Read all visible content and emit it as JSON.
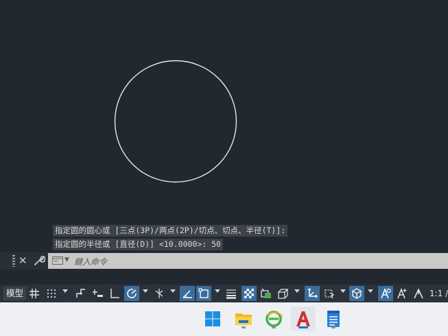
{
  "command_history": [
    "指定圆的圆心或 [三点(3P)/两点(2P)/切点、切点、半径(T)]:",
    "指定圆的半径或 [直径(D)] <10.0000>: 50"
  ],
  "command_line": {
    "placeholder": "鍵入命令",
    "close_glyph": "✕"
  },
  "status_bar": {
    "model_tab": "模型",
    "scale": "1:1 /"
  },
  "colors": {
    "canvas_bg": "#212830",
    "circle_stroke": "#e8eaec",
    "active_toggle": "#3b6d9a"
  },
  "taskbar": {
    "apps": [
      "windows-start",
      "file-explorer",
      "browser",
      "autocad",
      "notepad"
    ],
    "active_app": "autocad"
  }
}
